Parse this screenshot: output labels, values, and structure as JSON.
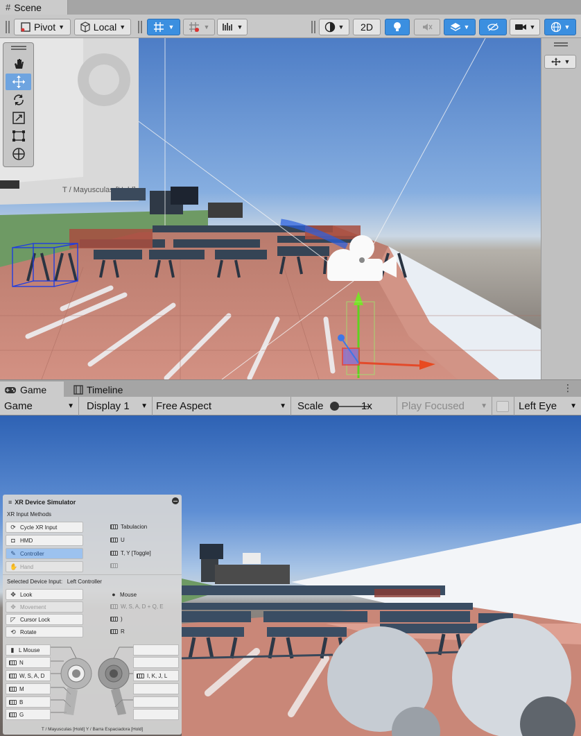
{
  "scene_tab": {
    "label": "Scene"
  },
  "toolbar": {
    "pivot_label": "Pivot",
    "local_label": "Local",
    "mode_2d_label": "2D"
  },
  "scene_labels": {
    "sign_text": "T / Mayusculas [Hold]"
  },
  "game_tabs": {
    "game_label": "Game",
    "timeline_label": "Timeline"
  },
  "game_toolbar": {
    "view_label": "Game",
    "display_label": "Display 1",
    "aspect_label": "Free Aspect",
    "scale_label": "Scale",
    "scale_value": "1x",
    "scale_fraction": 0.0,
    "play_mode_label": "Play Focused",
    "eye_label": "Left Eye"
  },
  "xr": {
    "title": "XR Device Simulator",
    "input_methods_label": "XR Input Methods",
    "methods": [
      {
        "label": "Cycle XR Input",
        "key": "Tabulacion"
      },
      {
        "label": "HMD",
        "key": "U"
      },
      {
        "label": "Controller",
        "key": "T, Y [Toggle]"
      },
      {
        "label": "Hand",
        "key": ""
      }
    ],
    "selected_label": "Selected Device Input:",
    "selected_value": "Left Controller",
    "device_controls": [
      {
        "label": "Look",
        "key": "Mouse"
      },
      {
        "label": "Movement",
        "key": "W, S, A, D + Q, E"
      },
      {
        "label": "Cursor Lock",
        "key": ")"
      },
      {
        "label": "Rotate",
        "key": "R"
      }
    ],
    "controller_left": [
      {
        "label": "L Mouse"
      },
      {
        "label": "N"
      },
      {
        "label": "W, S, A, D"
      },
      {
        "label": "M"
      },
      {
        "label": "B"
      },
      {
        "label": "G"
      }
    ],
    "controller_right": [
      {
        "label": ""
      },
      {
        "label": ""
      },
      {
        "label": "I, K, J, L"
      },
      {
        "label": ""
      },
      {
        "label": ""
      },
      {
        "label": ""
      }
    ],
    "footer": "T / Mayusculas [Hold]   Y / Barra Espaciadora [Hold]"
  },
  "colors": {
    "accent": "#3b8fe0",
    "toolbar_bg": "#c8c8c8",
    "track": "#c98778"
  }
}
